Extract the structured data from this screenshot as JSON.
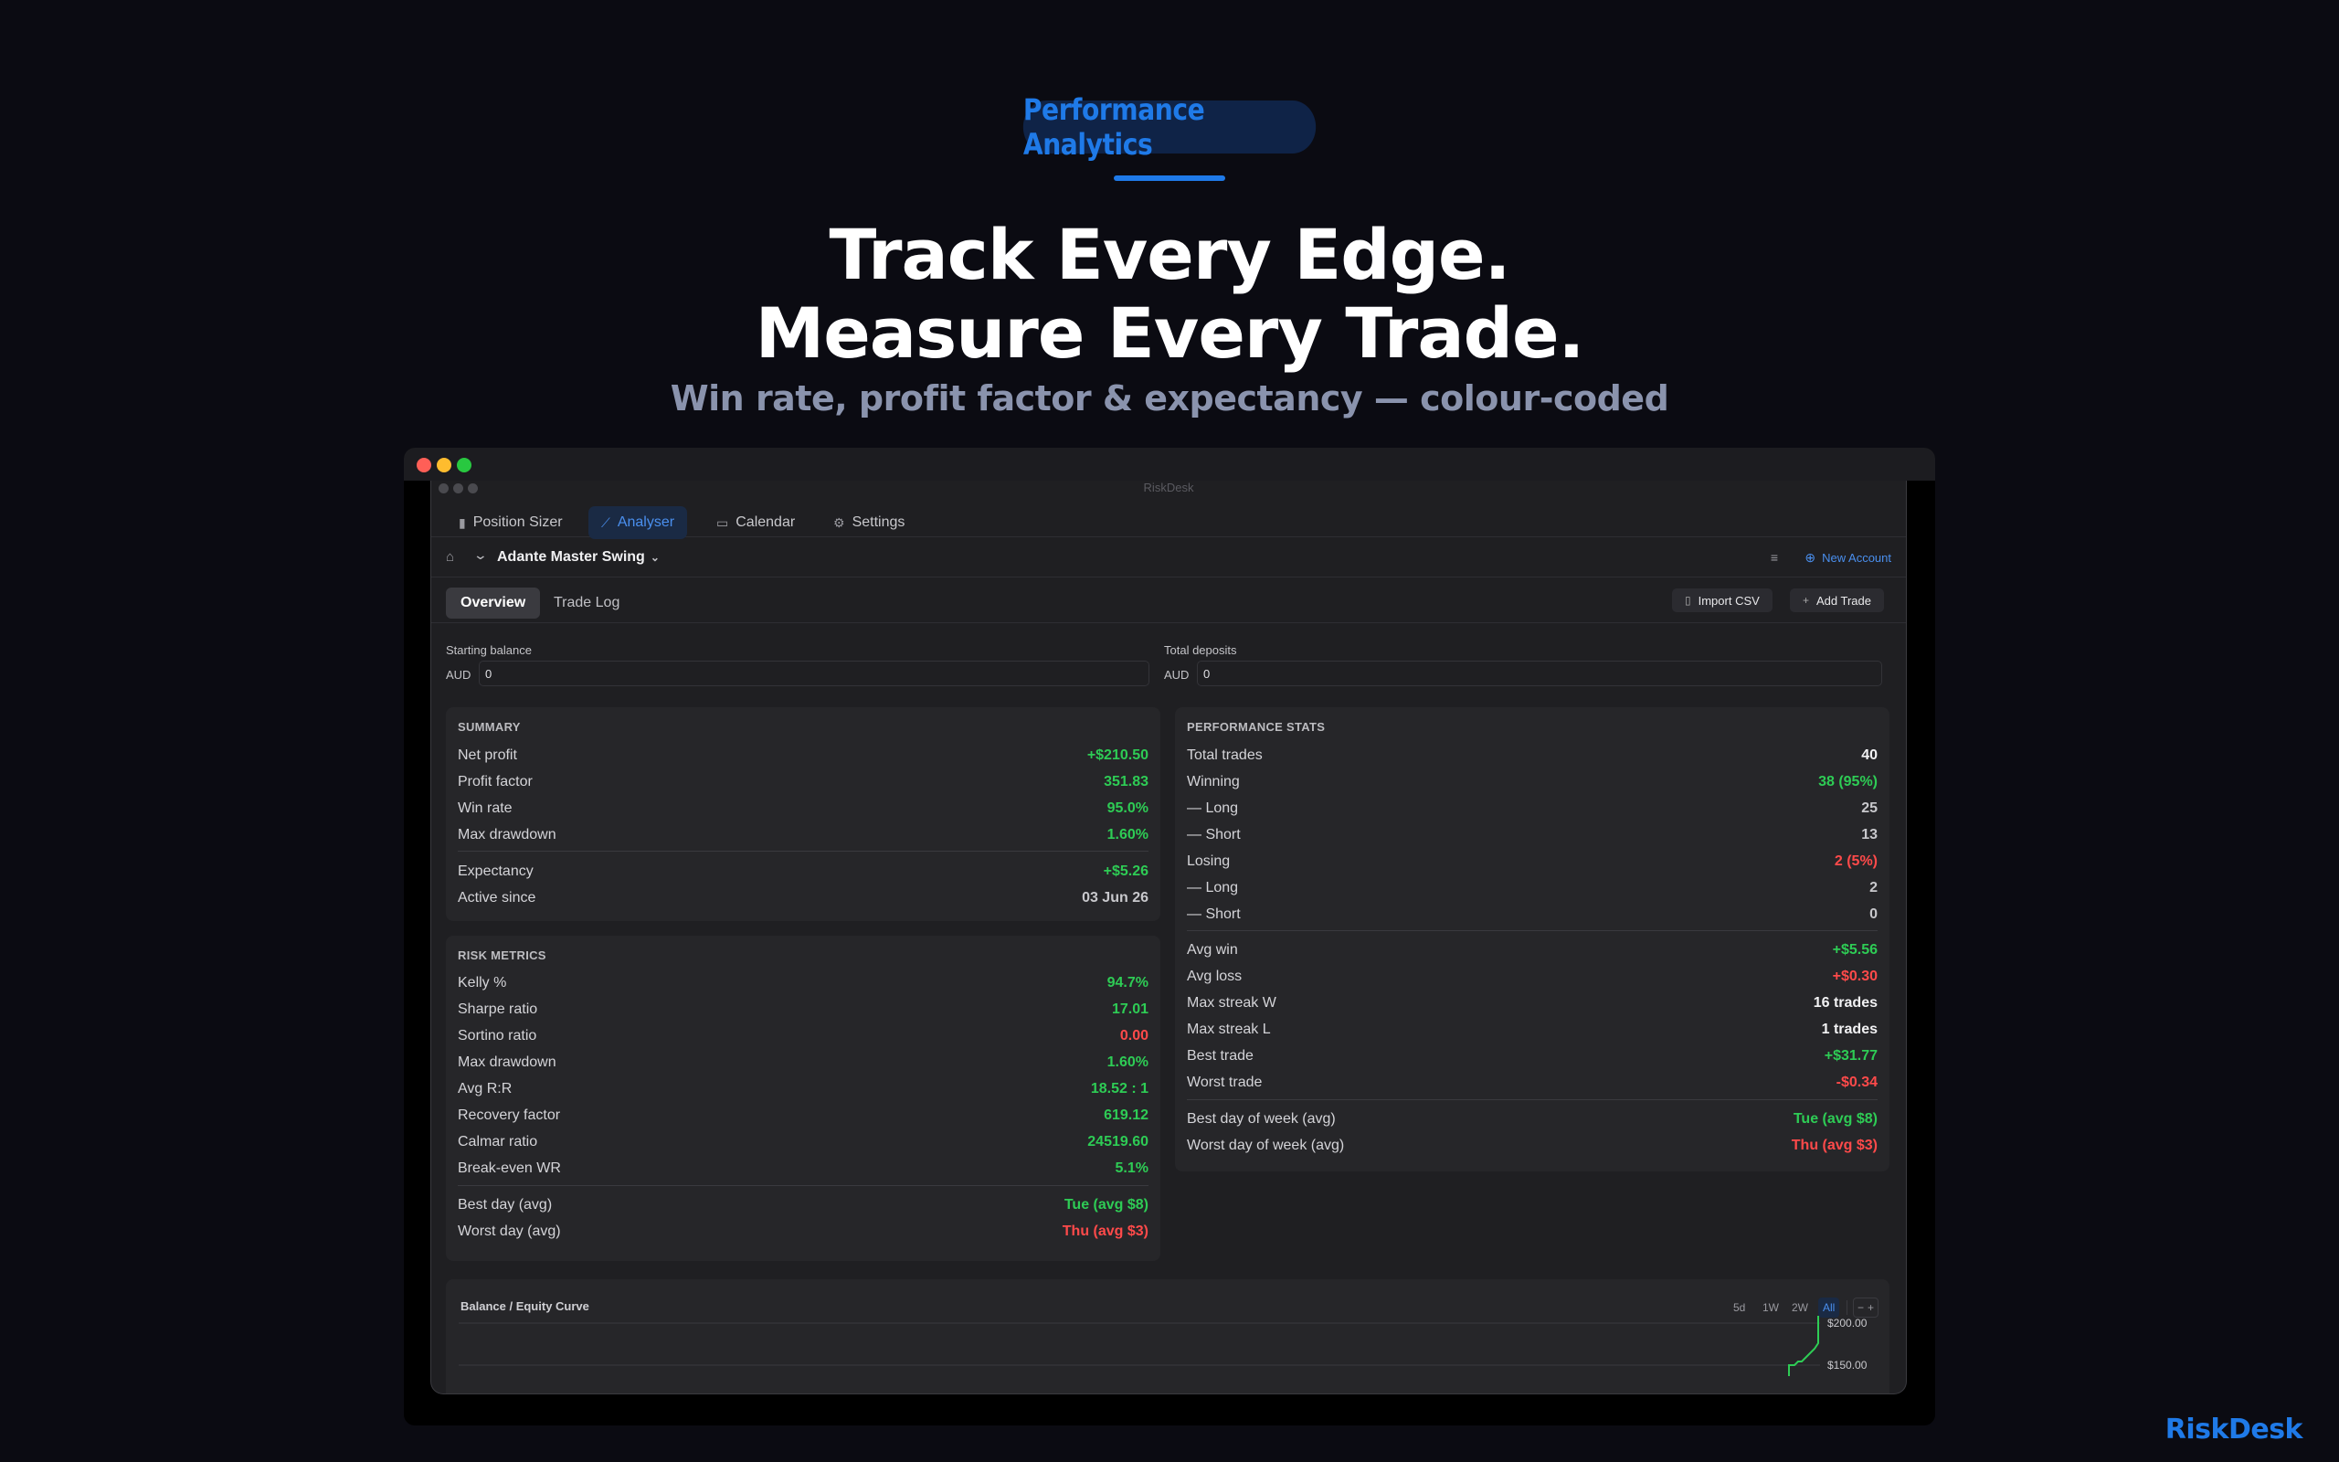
{
  "hero": {
    "badge": "Performance Analytics",
    "title_line1": "Track Every Edge.",
    "title_line2": "Measure Every Trade.",
    "subtitle": "Win rate, profit factor & expectancy — colour-coded",
    "brand": "RiskDesk"
  },
  "app": {
    "window_title": "RiskDesk",
    "nav_tabs": [
      {
        "label": "Position Sizer",
        "icon": "bar-chart-icon"
      },
      {
        "label": "Analyser",
        "icon": "line-chart-icon",
        "active": true
      },
      {
        "label": "Calendar",
        "icon": "calendar-icon"
      },
      {
        "label": "Settings",
        "icon": "gear-icon"
      }
    ],
    "account_name": "Adante Master Swing",
    "new_account_label": "New Account",
    "sub_tabs": [
      {
        "label": "Overview",
        "active": true
      },
      {
        "label": "Trade Log"
      }
    ],
    "import_csv_label": "Import CSV",
    "add_trade_label": "Add Trade",
    "starting_balance": {
      "label": "Starting balance",
      "currency": "AUD",
      "value": "0"
    },
    "total_deposits": {
      "label": "Total deposits",
      "currency": "AUD",
      "value": "0"
    }
  },
  "summary": {
    "title": "SUMMARY",
    "rows": [
      {
        "label": "Net profit",
        "value": "+$210.50",
        "tone": "pos"
      },
      {
        "label": "Profit factor",
        "value": "351.83",
        "tone": "pos"
      },
      {
        "label": "Win rate",
        "value": "95.0%",
        "tone": "pos"
      },
      {
        "label": "Max drawdown",
        "value": "1.60%",
        "tone": "pos"
      },
      {
        "label": "Expectancy",
        "value": "+$5.26",
        "tone": "pos"
      },
      {
        "label": "Active since",
        "value": "03 Jun 26",
        "tone": "muted"
      }
    ]
  },
  "risk_metrics": {
    "title": "RISK METRICS",
    "rows": [
      {
        "label": "Kelly %",
        "value": "94.7%",
        "tone": "pos"
      },
      {
        "label": "Sharpe ratio",
        "value": "17.01",
        "tone": "pos"
      },
      {
        "label": "Sortino ratio",
        "value": "0.00",
        "tone": "neg"
      },
      {
        "label": "Max drawdown",
        "value": "1.60%",
        "tone": "pos"
      },
      {
        "label": "Avg R:R",
        "value": "18.52 : 1",
        "tone": "pos"
      },
      {
        "label": "Recovery factor",
        "value": "619.12",
        "tone": "pos"
      },
      {
        "label": "Calmar ratio",
        "value": "24519.60",
        "tone": "pos"
      },
      {
        "label": "Break-even WR",
        "value": "5.1%",
        "tone": "pos"
      },
      {
        "label": "Best day (avg)",
        "value": "Tue (avg $8)",
        "tone": "pos"
      },
      {
        "label": "Worst day (avg)",
        "value": "Thu (avg $3)",
        "tone": "neg"
      }
    ]
  },
  "performance_stats": {
    "title": "PERFORMANCE STATS",
    "rows": [
      {
        "label": "Total trades",
        "value": "40",
        "tone": "neu"
      },
      {
        "label": "Winning",
        "value": "38 (95%)",
        "tone": "pos"
      },
      {
        "label": "— Long",
        "value": "25",
        "tone": "muted"
      },
      {
        "label": "— Short",
        "value": "13",
        "tone": "muted"
      },
      {
        "label": "Losing",
        "value": "2 (5%)",
        "tone": "neg"
      },
      {
        "label": "— Long",
        "value": "2",
        "tone": "muted"
      },
      {
        "label": "— Short",
        "value": "0",
        "tone": "muted"
      },
      {
        "label": "Avg win",
        "value": "+$5.56",
        "tone": "pos"
      },
      {
        "label": "Avg loss",
        "value": "+$0.30",
        "tone": "neg"
      },
      {
        "label": "Max streak W",
        "value": "16 trades",
        "tone": "neu"
      },
      {
        "label": "Max streak L",
        "value": "1 trades",
        "tone": "neu"
      },
      {
        "label": "Best trade",
        "value": "+$31.77",
        "tone": "pos"
      },
      {
        "label": "Worst trade",
        "value": "-$0.34",
        "tone": "neg"
      },
      {
        "label": "Best day of week (avg)",
        "value": "Tue (avg $8)",
        "tone": "pos"
      },
      {
        "label": "Worst day of week (avg)",
        "value": "Thu (avg $3)",
        "tone": "neg"
      }
    ]
  },
  "equity_chart": {
    "title": "Balance / Equity Curve",
    "ranges": [
      "5d",
      "1W",
      "2W",
      "All"
    ],
    "active_range": "All",
    "zoom_out": "−",
    "zoom_in": "+",
    "y_ticks": [
      "$200.00",
      "$150.00"
    ],
    "line_color": "#2ecc55"
  }
}
